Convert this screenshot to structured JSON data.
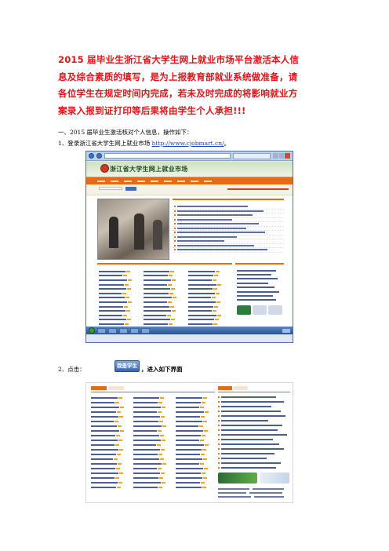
{
  "notice": {
    "lines": [
      "2015 届毕业生浙江省大学生网上就业市场平台激活本人信",
      "息及综合素质的填写，是为上报教育部就业系统做准备，请",
      "各位学生在规定时间内完成，若未及时完成的将影响就业方",
      "案录入报到证打印等后果将由学生个人承担!!!"
    ]
  },
  "intro": "一、2015 届毕业生激活核对个人信息，操作如下：",
  "step1": {
    "prefix": "1、登录浙江省大学生网上就业市场 ",
    "link": "http://www.cjobmart.cn/",
    "suffix": "。"
  },
  "screenshot1": {
    "site_title": "浙江省大学生网上就业市场"
  },
  "step2": {
    "prefix": "2、点击：",
    "button_label": "我是学生",
    "suffix": "，进入如下界面"
  }
}
